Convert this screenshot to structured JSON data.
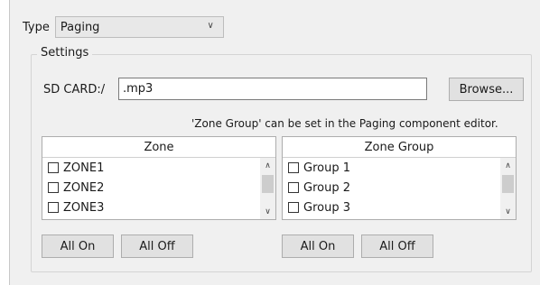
{
  "type": {
    "label": "Type",
    "selected": "Paging"
  },
  "settings": {
    "legend": "Settings",
    "sd_card_label": "SD CARD:/",
    "sd_card_value": ".mp3",
    "browse_label": "Browse...",
    "hint": "'Zone Group' can be set in the Paging component editor."
  },
  "zone_list": {
    "header": "Zone",
    "items": [
      "ZONE1",
      "ZONE2",
      "ZONE3"
    ],
    "all_on": "All On",
    "all_off": "All Off"
  },
  "group_list": {
    "header": "Zone Group",
    "items": [
      "Group 1",
      "Group 2",
      "Group 3"
    ],
    "all_on": "All On",
    "all_off": "All Off"
  }
}
